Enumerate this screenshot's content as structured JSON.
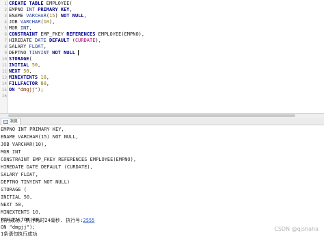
{
  "editor": {
    "line_numbers": [
      "1",
      "2",
      "3",
      "4",
      "5",
      "6",
      "7",
      "8",
      "9",
      "10",
      "11",
      "12",
      "13",
      "14",
      "15",
      "16"
    ],
    "lines": [
      [
        {
          "t": "CREATE TABLE ",
          "c": "kw"
        },
        {
          "t": "EMPLOYEE",
          "c": ""
        },
        {
          "t": "(",
          "c": ""
        }
      ],
      [
        {
          "t": "EMPNO ",
          "c": ""
        },
        {
          "t": "INT ",
          "c": "ty"
        },
        {
          "t": "PRIMARY KEY",
          "c": "kw"
        },
        {
          "t": ",",
          "c": ""
        }
      ],
      [
        {
          "t": "ENAME ",
          "c": ""
        },
        {
          "t": "VARCHAR",
          "c": "ty"
        },
        {
          "t": "(",
          "c": ""
        },
        {
          "t": "15",
          "c": "num"
        },
        {
          "t": ") ",
          "c": ""
        },
        {
          "t": "NOT NULL",
          "c": "kw"
        },
        {
          "t": ",",
          "c": ""
        }
      ],
      [
        {
          "t": "JOB ",
          "c": ""
        },
        {
          "t": "VARCHAR",
          "c": "ty"
        },
        {
          "t": "(",
          "c": ""
        },
        {
          "t": "10",
          "c": "num"
        },
        {
          "t": "),",
          "c": ""
        }
      ],
      [
        {
          "t": "MGR ",
          "c": ""
        },
        {
          "t": "INT",
          "c": "ty"
        },
        {
          "t": ",",
          "c": ""
        }
      ],
      [
        {
          "t": "CONSTRAINT ",
          "c": "kw"
        },
        {
          "t": "EMP_FKEY ",
          "c": ""
        },
        {
          "t": "REFERENCES ",
          "c": "kw"
        },
        {
          "t": "EMPLOYEE(EMPNO),",
          "c": ""
        }
      ],
      [
        {
          "t": "HIREDATE ",
          "c": ""
        },
        {
          "t": "DATE ",
          "c": "ty"
        },
        {
          "t": "DEFAULT ",
          "c": "kw"
        },
        {
          "t": "(",
          "c": ""
        },
        {
          "t": "CURDATE",
          "c": "fn"
        },
        {
          "t": "),",
          "c": ""
        }
      ],
      [
        {
          "t": "SALARY ",
          "c": ""
        },
        {
          "t": "FLOAT",
          "c": "ty"
        },
        {
          "t": ",",
          "c": ""
        }
      ],
      [
        {
          "t": "DEPTNO ",
          "c": ""
        },
        {
          "t": "TINYINT ",
          "c": "ty"
        },
        {
          "t": "NOT NULL",
          "c": "kw"
        }
      ],
      [
        {
          "t": "STORAGE",
          "c": "kw"
        },
        {
          "t": "(",
          "c": ""
        }
      ],
      [
        {
          "t": "INITIAL ",
          "c": "kw"
        },
        {
          "t": "50",
          "c": "num"
        },
        {
          "t": ",",
          "c": ""
        }
      ],
      [
        {
          "t": "NEXT ",
          "c": "kw"
        },
        {
          "t": "50",
          "c": "num"
        },
        {
          "t": ",",
          "c": ""
        }
      ],
      [
        {
          "t": "MINEXTENTS ",
          "c": "kw"
        },
        {
          "t": "10",
          "c": "num"
        },
        {
          "t": ",",
          "c": ""
        }
      ],
      [
        {
          "t": "FILLFACTOR ",
          "c": "kw"
        },
        {
          "t": "80",
          "c": "num"
        },
        {
          "t": ",",
          "c": ""
        }
      ],
      [
        {
          "t": "ON ",
          "c": "kw"
        },
        {
          "t": "\"dmgjj\"",
          "c": "str"
        },
        {
          "t": ");",
          "c": ""
        }
      ],
      [
        {
          "t": "",
          "c": ""
        }
      ]
    ]
  },
  "messages": {
    "tab_label": "消息",
    "lines": [
      "EMPNO INT PRIMARY KEY,",
      "ENAME VARCHAR(15) NOT NULL,",
      "JOB VARCHAR(10),",
      "MGR INT",
      "CONSTRAINT EMP_FKEY REFERENCES EMPLOYEE(EMPNO),",
      "HIREDATE DATE DEFAULT (CURDATE),",
      "SALARY FLOAT,",
      "DEPTNO TINYINT NOT NULL)",
      "STORAGE (",
      "INITIAL 50,",
      "NEXT 50,",
      "MINEXTENTS 10,",
      "FILLFACTOR 80,",
      "ON \"dmgjj\");"
    ],
    "exec_result_prefix": "执行成功, 执行耗时24毫秒. 执行号:",
    "exec_number": "2555",
    "summary": "1条语句执行成功"
  },
  "watermark": "CSDN @qjshaha",
  "colors": {
    "keyword": "#00008b",
    "type": "#1e3a8a",
    "number": "#8b6d00",
    "string": "#7a2a00",
    "function": "#a0006a",
    "link": "#1e4fc2"
  }
}
